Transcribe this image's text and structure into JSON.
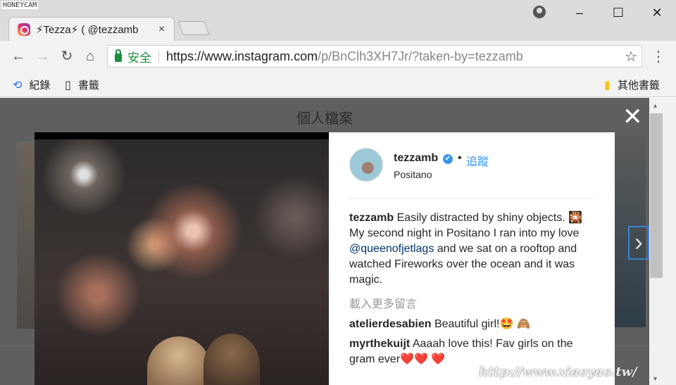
{
  "watermark_top_left": "HONEYCAM",
  "tab": {
    "title": "⚡Tezza⚡ ( @tezzamb",
    "close": "×"
  },
  "window_controls": {
    "minimize": "–",
    "maximize": "☐",
    "close": "✕"
  },
  "toolbar": {
    "back": "←",
    "forward": "→",
    "reload": "↻",
    "home": "⌂",
    "secure_label": "安全",
    "url_host": "https://www.instagram.com",
    "url_path": "/p/BnClh3XH7Jr/?taken-by=tezzamb",
    "star": "☆",
    "menu": "⋮"
  },
  "bookmarks": {
    "history_label": "紀錄",
    "bookmarks_label": "書籤",
    "other_label": "其他書籤"
  },
  "page": {
    "header_title": "個人檔案",
    "close_modal": "✕",
    "next": "›"
  },
  "post": {
    "username": "tezzamb",
    "verified_badge": "✔",
    "dot": "•",
    "follow_label": "追蹤",
    "location": "Positano",
    "caption_user": "tezzamb",
    "caption_text_1": " Easily distracted by shiny objects. 🎇 My second night in Positano I ran into my love ",
    "caption_mention": "@queenofjetlags",
    "caption_text_2": " and we sat on a rooftop and watched Fireworks over the ocean and it was magic.",
    "load_more": "載入更多留言",
    "comments": [
      {
        "user": "atelierdesabien",
        "text": " Beautiful girl!🤩 🙈"
      },
      {
        "user": "myrthekuijt",
        "text": " Aaaah love this! Fav girls on the gram ever❤️❤️ ❤️"
      }
    ]
  },
  "watermark_bottom_right": "http://www.xiaoyao.tw/",
  "colors": {
    "secure_green": "#1e8e3e",
    "link_blue": "#3897f0",
    "overlay": "#5f5f5f"
  }
}
